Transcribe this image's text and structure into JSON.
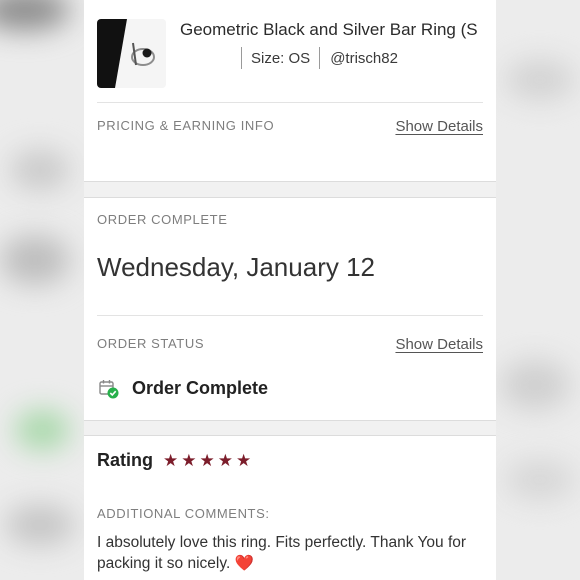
{
  "product": {
    "title": "Geometric Black and Silver Bar Ring (S",
    "size": "Size: OS",
    "seller": "@trisch82",
    "image_icon": "ring-photo"
  },
  "pricing": {
    "label": "PRICING & EARNING INFO",
    "link": "Show Details"
  },
  "order_complete": {
    "label": "ORDER COMPLETE",
    "date": "Wednesday, January 12"
  },
  "order_status": {
    "label": "ORDER STATUS",
    "link": "Show Details",
    "status": "Order Complete",
    "icon": "calendar-check-icon"
  },
  "rating": {
    "label": "Rating",
    "stars": 5,
    "star_color": "#7c1d2b"
  },
  "comments": {
    "label": "ADDITIONAL COMMENTS:",
    "text": "I absolutely love this ring. Fits perfectly. Thank You for packing it so nicely.",
    "emoji": "❤️"
  }
}
